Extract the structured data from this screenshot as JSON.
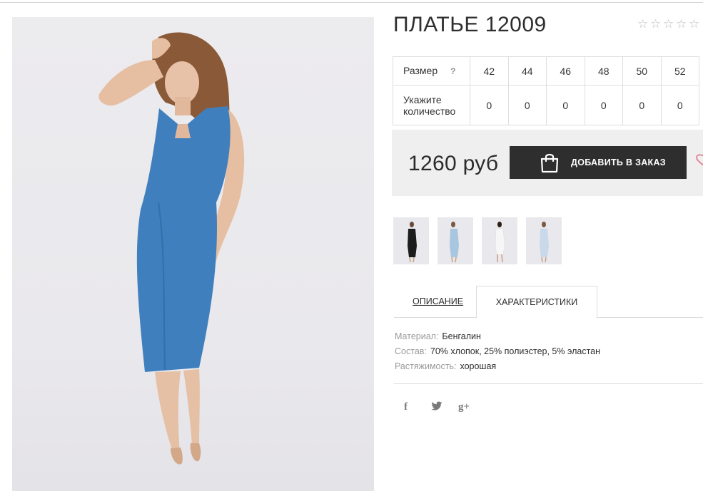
{
  "product": {
    "title": "ПЛАТЬЕ 12009",
    "rating": {
      "value": 0,
      "max": 5
    }
  },
  "sizes": {
    "row_label": "Размер",
    "help": "?",
    "values": [
      "42",
      "44",
      "46",
      "48",
      "50",
      "52"
    ],
    "qty_label_line1": "Укажите",
    "qty_label_line2": "количество",
    "quantities": [
      "0",
      "0",
      "0",
      "0",
      "0",
      "0"
    ]
  },
  "purchase": {
    "price": "1260 руб",
    "button_label": "ДОБАВИТЬ В ЗАКАЗ"
  },
  "thumbnails": [
    {
      "dress_color": "#1c1c1c"
    },
    {
      "dress_color": "#a8c6e0"
    },
    {
      "dress_color": "#f6f6f6"
    },
    {
      "dress_color": "#c9d9ea"
    }
  ],
  "tabs": {
    "description": "ОПИСАНИЕ",
    "characteristics": "ХАРАКТЕРИСТИКИ"
  },
  "specs": [
    {
      "key": "Материал:",
      "value": "Бенгалин"
    },
    {
      "key": "Состав:",
      "value": "70% хлопок, 25% полиэстер, 5% эластан"
    },
    {
      "key": "Растяжимость:",
      "value": "хорошая"
    }
  ],
  "social": {
    "facebook": "f",
    "google": "g+"
  },
  "colors": {
    "dress_blue": "#3f7fbd",
    "dark_button": "#2e2e2e",
    "heart": "#e48a9c"
  }
}
